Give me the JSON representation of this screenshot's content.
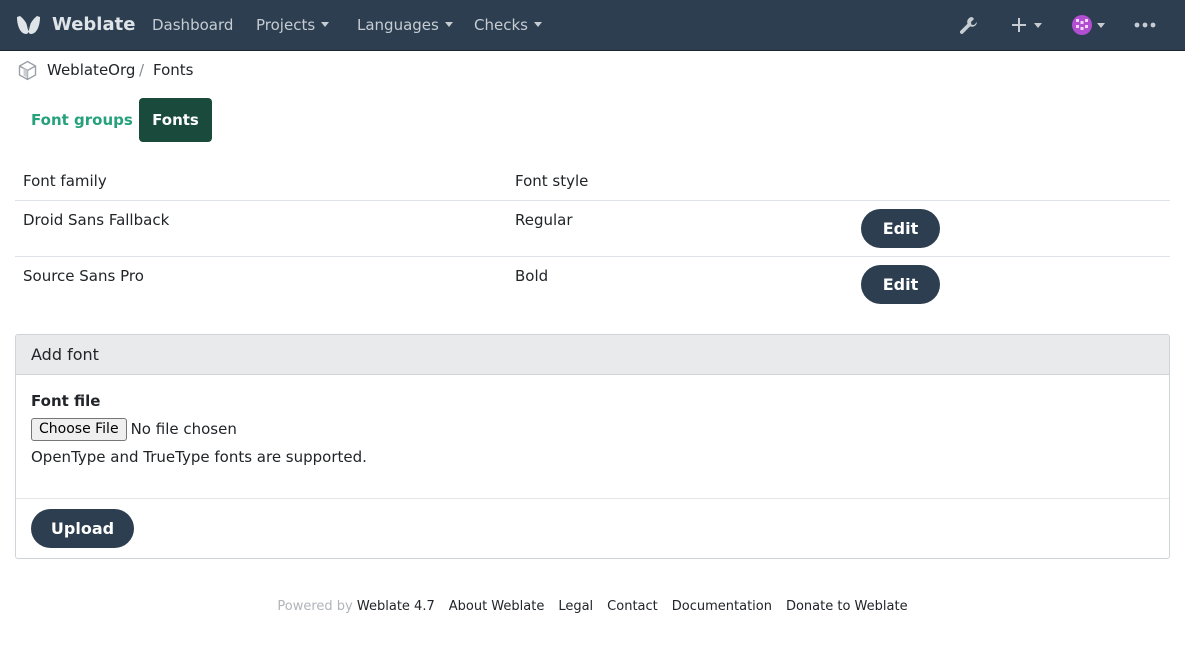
{
  "navbar": {
    "brand": "Weblate",
    "links": {
      "dashboard": "Dashboard",
      "projects": "Projects",
      "languages": "Languages",
      "checks": "Checks"
    },
    "icons": [
      "weblate-logo-icon",
      "wrench-icon",
      "plus-icon",
      "user-avatar-icon",
      "more-icon"
    ]
  },
  "breadcrumb": {
    "org": "WeblateOrg",
    "separator": "/",
    "current": "Fonts"
  },
  "tabs": {
    "font_groups": "Font groups",
    "fonts": "Fonts"
  },
  "table": {
    "headers": {
      "family": "Font family",
      "style": "Font style"
    },
    "rows": [
      {
        "family": "Droid Sans Fallback",
        "style": "Regular",
        "action": "Edit"
      },
      {
        "family": "Source Sans Pro",
        "style": "Bold",
        "action": "Edit"
      }
    ]
  },
  "add_font": {
    "title": "Add font",
    "field_label": "Font file",
    "file_button": "Choose File",
    "file_status": "No file chosen",
    "help": "OpenType and TrueType fonts are supported.",
    "submit": "Upload"
  },
  "footer": {
    "powered_by": "Powered by",
    "version": "Weblate 4.7",
    "links": {
      "about": "About Weblate",
      "legal": "Legal",
      "contact": "Contact",
      "documentation": "Documentation",
      "donate": "Donate to Weblate"
    }
  },
  "colors": {
    "navbar": "#2c3e50",
    "accent": "#26a17b",
    "active_tab": "#1a4a3c",
    "button": "#2c3e50"
  }
}
